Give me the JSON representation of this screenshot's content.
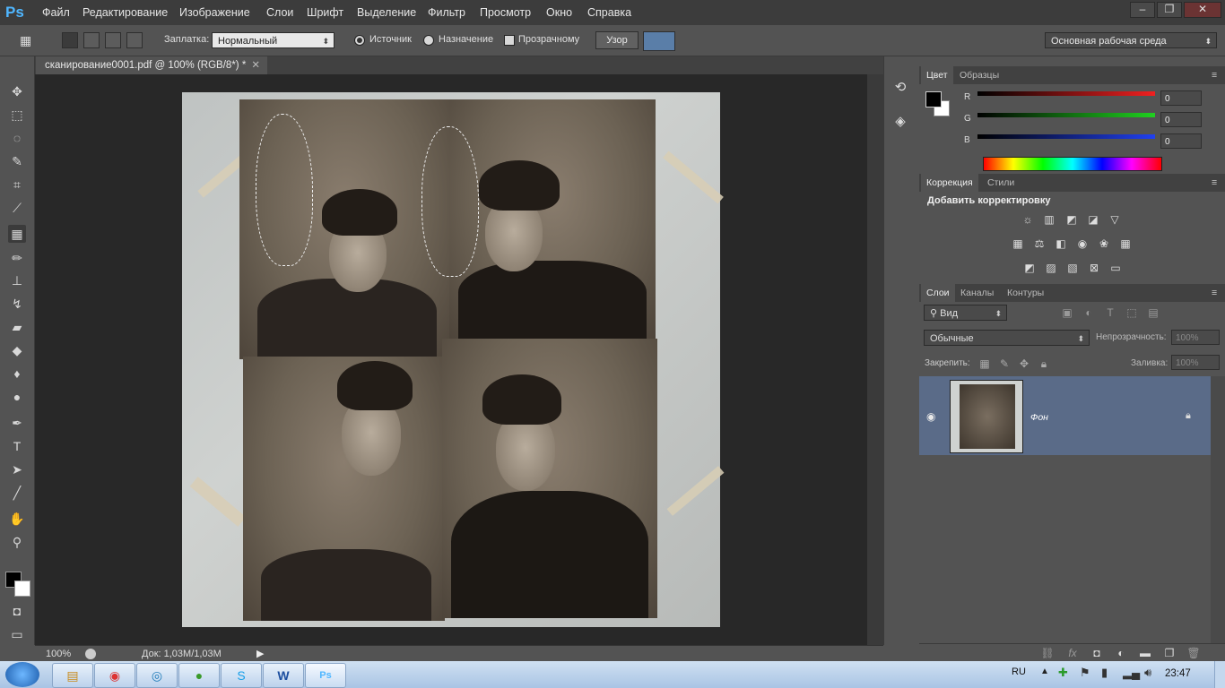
{
  "app": {
    "logo": "Ps"
  },
  "menu": [
    "Файл",
    "Редактирование",
    "Изображение",
    "Слои",
    "Шрифт",
    "Выделение",
    "Фильтр",
    "Просмотр",
    "Окно",
    "Справка"
  ],
  "window_buttons": [
    "–",
    "❐",
    "✕"
  ],
  "options": {
    "fill_label": "Заплатка:",
    "fill_value": "Нормальный",
    "source_label": "Источник",
    "dest_label": "Назначение",
    "transparent_label": "Прозрачному",
    "pattern_button": "Узор",
    "workspace": "Основная рабочая среда"
  },
  "document": {
    "tab_title": "сканирование0001.pdf @ 100% (RGB/8*) *",
    "zoom": "100%",
    "doc_size": "Док: 1,03M/1,03M"
  },
  "color_panel": {
    "tabs": [
      "Цвет",
      "Образцы"
    ],
    "channels": [
      {
        "label": "R",
        "value": "0",
        "color": "#e03030"
      },
      {
        "label": "G",
        "value": "0",
        "color": "#30c030"
      },
      {
        "label": "B",
        "value": "0",
        "color": "#3050e0"
      }
    ]
  },
  "adjust_panel": {
    "tabs": [
      "Коррекция",
      "Стили"
    ],
    "heading": "Добавить корректировку"
  },
  "layers_panel": {
    "tabs": [
      "Слои",
      "Каналы",
      "Контуры"
    ],
    "kind": "Вид",
    "blend": "Обычные",
    "opacity_label": "Непрозрачность:",
    "opacity_value": "100%",
    "lock_label": "Закрепить:",
    "fill_label": "Заливка:",
    "fill_value": "100%",
    "layer_name": "Фон"
  },
  "taskbar": {
    "lang": "RU",
    "time": "23:47"
  }
}
